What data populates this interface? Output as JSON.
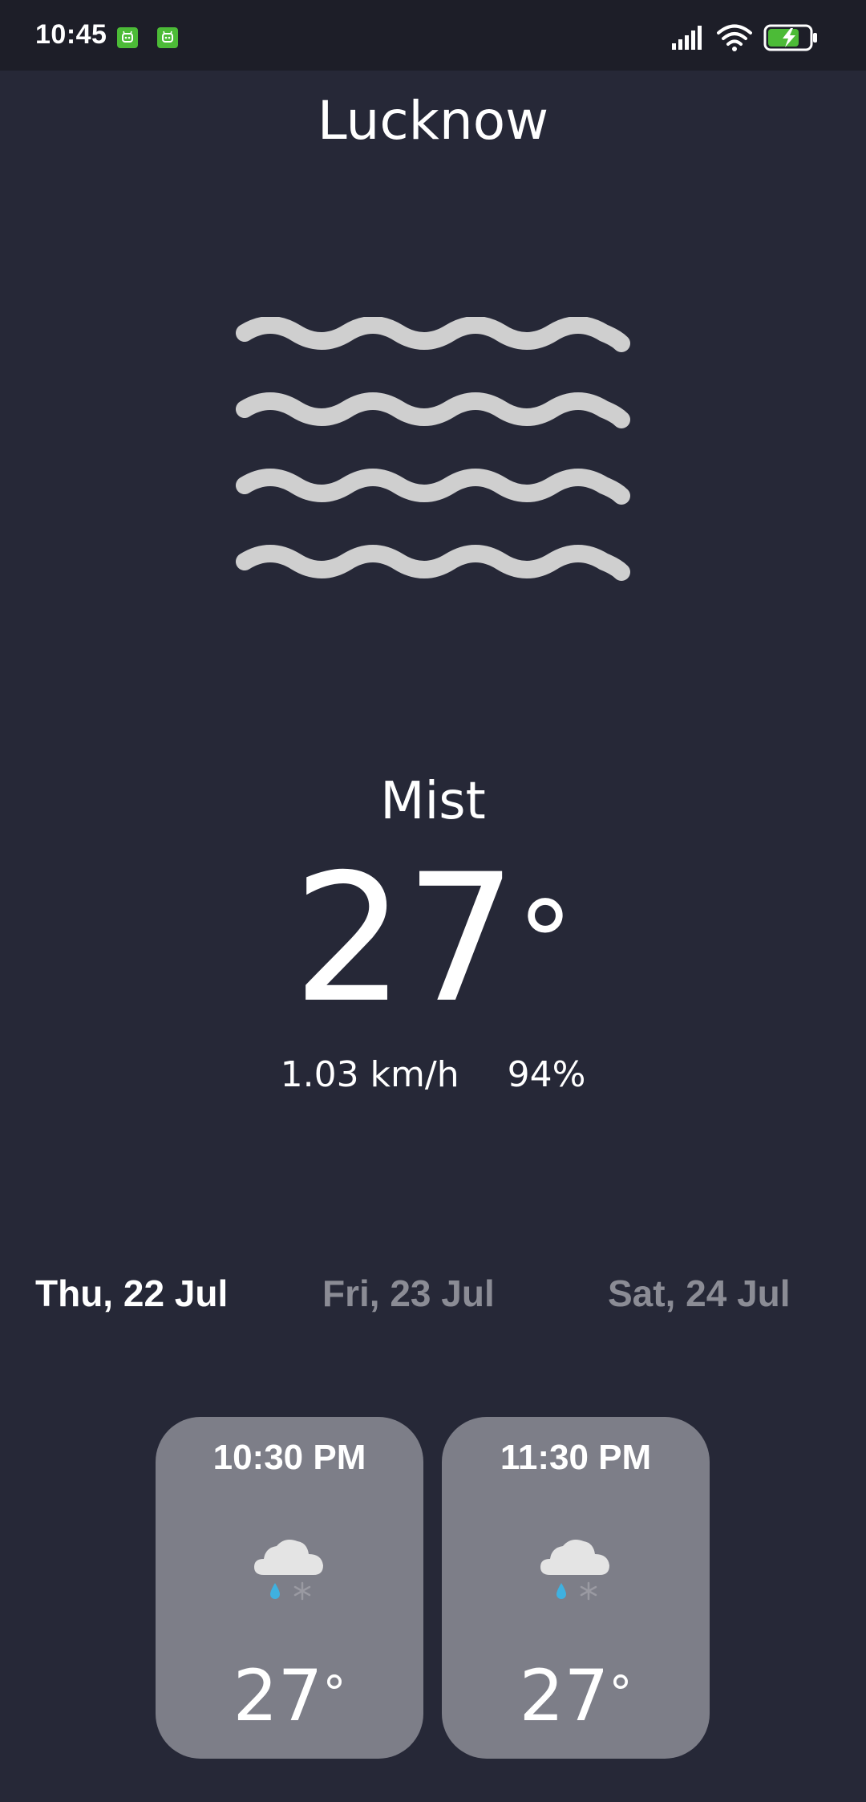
{
  "status_bar": {
    "time": "10:45",
    "notifications": [
      "app-notification-icon",
      "app-notification-icon"
    ],
    "icons": [
      "signal-icon",
      "wifi-icon",
      "battery-charging-icon"
    ],
    "accent_green": "#4cbb37"
  },
  "city": "Lucknow",
  "current": {
    "icon": "mist-icon",
    "condition": "Mist",
    "temperature": "27",
    "degree_symbol": "°",
    "wind": "1.03 km/h",
    "humidity": "94%"
  },
  "days": [
    {
      "label": "Thu, 22 Jul",
      "active": true
    },
    {
      "label": "Fri, 23 Jul",
      "active": false
    },
    {
      "label": "Sat, 24 Jul",
      "active": false
    }
  ],
  "hourly": [
    {
      "time": "10:30 PM",
      "icon": "rain-snow-cloud-icon",
      "temperature": "27",
      "degree_symbol": "°"
    },
    {
      "time": "11:30 PM",
      "icon": "rain-snow-cloud-icon",
      "temperature": "27",
      "degree_symbol": "°"
    }
  ],
  "colors": {
    "background": "#262837",
    "status_bar": "#1d1e28",
    "card": "#7d7e88",
    "inactive_text": "#8b8c95",
    "mist_stroke": "#cfcfcf",
    "rain_drop": "#3fb1e0"
  }
}
